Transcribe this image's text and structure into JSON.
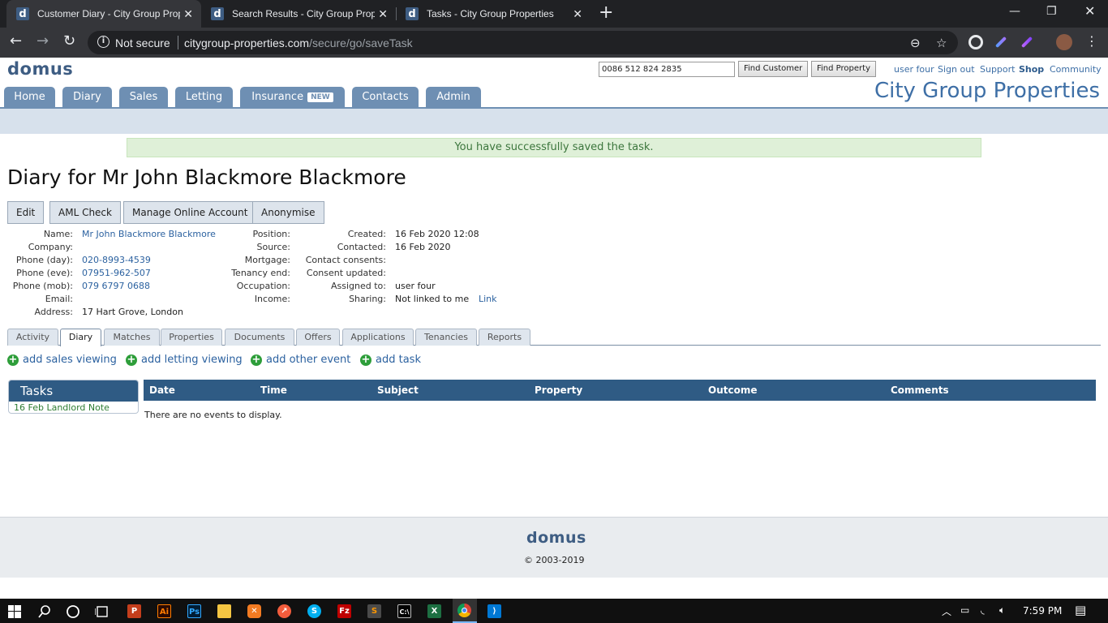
{
  "browser": {
    "tabs": [
      {
        "title": "Customer Diary - City Group Properties"
      },
      {
        "title": "Search Results - City Group Properties"
      },
      {
        "title": "Tasks - City Group Properties"
      }
    ],
    "security_label": "Not secure",
    "url_host": "citygroup-properties.com",
    "url_path": "/secure/go/saveTask"
  },
  "header": {
    "logo": "domus",
    "search_value": "0086 512 824 2835",
    "find_customer": "Find Customer",
    "find_property": "Find Property",
    "links": [
      "user four",
      "Sign out",
      "Support",
      "Shop",
      "Community"
    ],
    "company_name": "City Group Properties"
  },
  "nav": {
    "tabs": [
      "Home",
      "Diary",
      "Sales",
      "Letting",
      "Insurance",
      "Contacts",
      "Admin"
    ],
    "new_badge": "NEW"
  },
  "flash_message": "You have successfully saved the task.",
  "page_title": "Diary for Mr John Blackmore Blackmore",
  "actions": [
    "Edit",
    "AML Check",
    "Manage Online Account",
    "Anonymise"
  ],
  "customer": {
    "col1": [
      {
        "label": "Name:",
        "value": "Mr John Blackmore Blackmore",
        "link": true
      },
      {
        "label": "Company:",
        "value": ""
      },
      {
        "label": "Phone (day):",
        "value": "020-8993-4539",
        "link": true
      },
      {
        "label": "Phone (eve):",
        "value": "07951-962-507",
        "link": true
      },
      {
        "label": "Phone (mob):",
        "value": "079 6797 0688",
        "link": true
      },
      {
        "label": "Email:",
        "value": ""
      },
      {
        "label": "Address:",
        "value": "17 Hart Grove, London"
      }
    ],
    "col2": [
      {
        "label": "Position:",
        "value": ""
      },
      {
        "label": "Source:",
        "value": ""
      },
      {
        "label": "Mortgage:",
        "value": ""
      },
      {
        "label": "Tenancy end:",
        "value": ""
      },
      {
        "label": "Occupation:",
        "value": ""
      },
      {
        "label": "Income:",
        "value": ""
      }
    ],
    "col3": [
      {
        "label": "Created:",
        "value": "16 Feb 2020 12:08"
      },
      {
        "label": "Contacted:",
        "value": "16 Feb 2020"
      },
      {
        "label": "Contact consents:",
        "value": ""
      },
      {
        "label": "Consent updated:",
        "value": ""
      },
      {
        "label": "Assigned to:",
        "value": "user four"
      },
      {
        "label": "Sharing:",
        "value": "Not linked to me"
      }
    ],
    "sharing_link": "Link"
  },
  "subtabs": [
    "Activity",
    "Diary",
    "Matches",
    "Properties",
    "Documents",
    "Offers",
    "Applications",
    "Tenancies",
    "Reports"
  ],
  "add_links": [
    "add sales viewing",
    "add letting viewing",
    "add other event",
    "add task"
  ],
  "tasks": {
    "title": "Tasks",
    "items": [
      "16 Feb Landlord Note"
    ]
  },
  "events": {
    "columns": [
      "Date",
      "Time",
      "Subject",
      "Property",
      "Outcome",
      "Comments"
    ],
    "empty_text": "There are no events to display."
  },
  "footer": {
    "logo": "domus",
    "copyright": "© 2003-2019"
  },
  "taskbar": {
    "time": "7:59 PM"
  }
}
